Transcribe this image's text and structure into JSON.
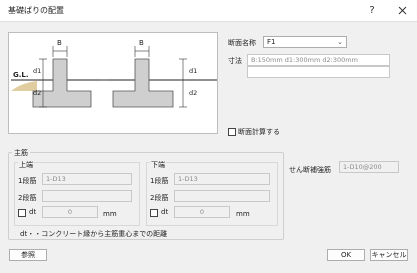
{
  "window": {
    "title": "基礎ばりの配置",
    "help_glyph": "?",
    "close_glyph": "X"
  },
  "diagram": {
    "label_b_left": "B",
    "label_b_right": "B",
    "label_gl": "G.L.",
    "label_d1_left": "d1",
    "label_d2_left": "d2",
    "label_d1_right": "d1",
    "label_d2_right": "d2"
  },
  "section": {
    "name_label": "断面名称",
    "name_value": "F1",
    "dims_label": "寸法",
    "dims_value": "B:150mm d1:300mm d2:300mm",
    "calc_label": "断面計算する"
  },
  "main_bar": {
    "group_label": "主筋",
    "upper": {
      "heading": "上端",
      "row1_label": "1段筋",
      "row1_value": "1-D13",
      "row2_label": "2段筋",
      "row2_value": "",
      "dt_label": "dt",
      "dt_value": "0",
      "dt_unit": "mm"
    },
    "lower": {
      "heading": "下端",
      "row1_label": "1段筋",
      "row1_value": "1-D13",
      "row2_label": "2段筋",
      "row2_value": "",
      "dt_label": "dt",
      "dt_value": "0",
      "dt_unit": "mm"
    },
    "note": "dt・・コンクリート縁から主筋重心までの距離"
  },
  "shear_bar": {
    "label": "せん断補強筋",
    "value": "1-D10@200"
  },
  "buttons": {
    "reference": "参照",
    "ok": "OK",
    "cancel": "キャンセル"
  }
}
